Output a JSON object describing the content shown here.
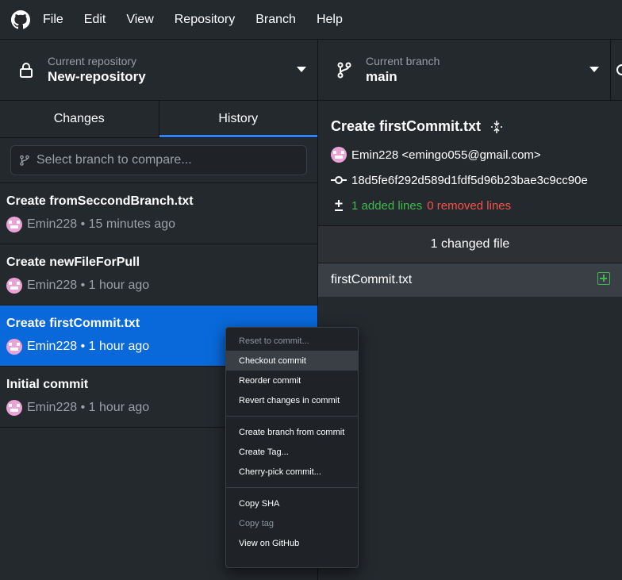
{
  "menubar": {
    "logo_icon": "github-mark-icon",
    "items": [
      "File",
      "Edit",
      "View",
      "Repository",
      "Branch",
      "Help"
    ]
  },
  "toolbar": {
    "repo_label": "Current repository",
    "repo_value": "New-repository",
    "branch_label": "Current branch",
    "branch_value": "main"
  },
  "sidebar": {
    "tabs": [
      {
        "label": "Changes",
        "active": false
      },
      {
        "label": "History",
        "active": true
      }
    ],
    "compare_placeholder": "Select branch to compare...",
    "commits": [
      {
        "title": "Create fromSeccondBranch.txt",
        "author": "Emin228",
        "time": "15 minutes ago",
        "selected": false
      },
      {
        "title": "Create newFileForPull",
        "author": "Emin228",
        "time": "1 hour ago",
        "selected": false
      },
      {
        "title": "Create firstCommit.txt",
        "author": "Emin228",
        "time": "1 hour ago",
        "selected": true
      },
      {
        "title": "Initial commit",
        "author": "Emin228",
        "time": "1 hour ago",
        "selected": false
      }
    ]
  },
  "detail": {
    "title": "Create firstCommit.txt",
    "author_line": "Emin228 <emingo055@gmail.com>",
    "sha": "18d5fe6f292d589d1fdf5d96b23bae3c9cc90e",
    "added": "1 added lines",
    "removed": "0 removed lines",
    "changed_files_header": "1 changed file",
    "files": [
      {
        "name": "firstCommit.txt",
        "status": "added"
      }
    ]
  },
  "context_menu": {
    "groups": [
      [
        {
          "label": "Reset to commit...",
          "disabled": true
        },
        {
          "label": "Checkout commit",
          "hovered": true
        },
        {
          "label": "Reorder commit"
        },
        {
          "label": "Revert changes in commit"
        }
      ],
      [
        {
          "label": "Create branch from commit"
        },
        {
          "label": "Create Tag..."
        },
        {
          "label": "Cherry-pick commit..."
        }
      ],
      [
        {
          "label": "Copy SHA"
        },
        {
          "label": "Copy tag",
          "disabled": true
        },
        {
          "label": "View on GitHub"
        }
      ]
    ]
  },
  "colors": {
    "background": "#24292e",
    "selected": "#0969da",
    "tab_accent": "#2f81f7",
    "added": "#3fb950",
    "removed": "#f85149"
  }
}
